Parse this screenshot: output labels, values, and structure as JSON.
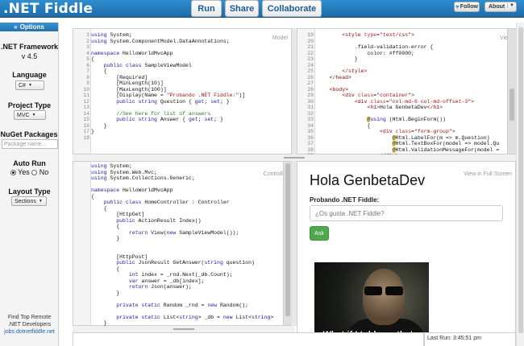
{
  "app": {
    "logo": ".NET Fiddle"
  },
  "toolbar": {
    "run": "Run",
    "share": "Share",
    "collaborate": "Collaborate",
    "follow": "Follow",
    "about": "About"
  },
  "sidebar": {
    "header": "Options",
    "framework_label": ".NET Framework",
    "framework_value": "v 4.5",
    "language_label": "Language",
    "language_value": "C#",
    "project_label": "Project Type",
    "project_value": "MVC",
    "nuget_label": "NuGet Packages",
    "nuget_placeholder": "Package name...",
    "autorun_label": "Auto Run",
    "autorun_yes": "Yes",
    "autorun_no": "No",
    "layout_label": "Layout Type",
    "layout_value": "Sections",
    "promo_line1": "Find Top Remote",
    "promo_line2": ".NET Developers",
    "promo_link": "jobs.dotnetfiddle.net"
  },
  "model_panel": {
    "tag": "Model"
  },
  "view_panel": {
    "tag": "View"
  },
  "controller_panel": {
    "tag": "Controller"
  },
  "output": {
    "tag": "View in Full Screen",
    "title": "Hola GenbetaDev",
    "label": "Probando .NET Fiddle:",
    "placeholder": "¿Os gusta .NET Fiddle?",
    "button": "Ask",
    "meme_caption": "What if I told you that..."
  },
  "status": {
    "last_run": "Last Run: 3:45:51 pm"
  }
}
